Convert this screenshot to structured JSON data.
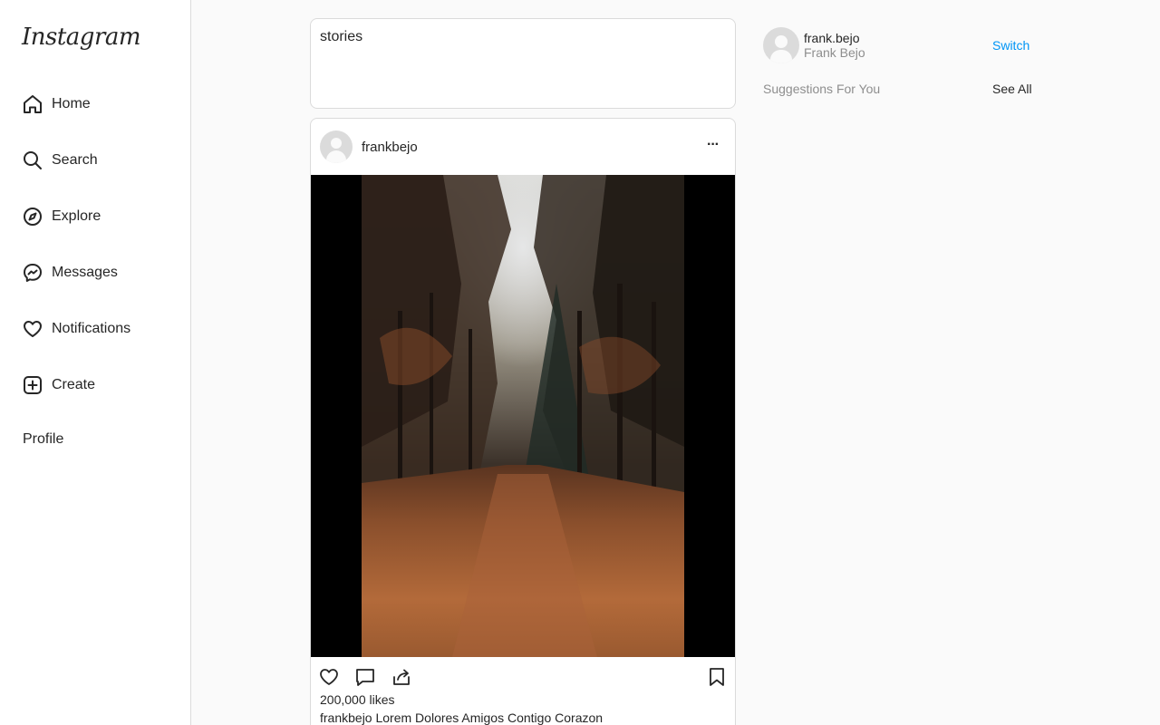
{
  "sidebar": {
    "logo": "Instagram",
    "items": [
      {
        "label": "Home",
        "icon": "home-icon"
      },
      {
        "label": "Search",
        "icon": "search-icon"
      },
      {
        "label": "Explore",
        "icon": "compass-icon"
      },
      {
        "label": "Messages",
        "icon": "messenger-icon"
      },
      {
        "label": "Notifications",
        "icon": "heart-icon"
      },
      {
        "label": "Create",
        "icon": "plus-square-icon"
      }
    ],
    "profile_label": "Profile"
  },
  "stories": {
    "label": "stories"
  },
  "post": {
    "username": "frankbejo",
    "more_label": "···",
    "likes": "200,000 likes",
    "caption_user": "frankbejo",
    "caption_text": " Lorem Dolores Amigos Contigo Corazon"
  },
  "current_user": {
    "username": "frank.bejo",
    "full_name": "Frank Bejo",
    "switch_label": "Switch"
  },
  "suggestions": {
    "title": "Suggestions For You",
    "see_all_label": "See All"
  },
  "colors": {
    "accent": "#0095f6",
    "text": "#262626",
    "muted": "#8e8e8e",
    "border": "#dbdbdb",
    "background": "#fafafa"
  }
}
